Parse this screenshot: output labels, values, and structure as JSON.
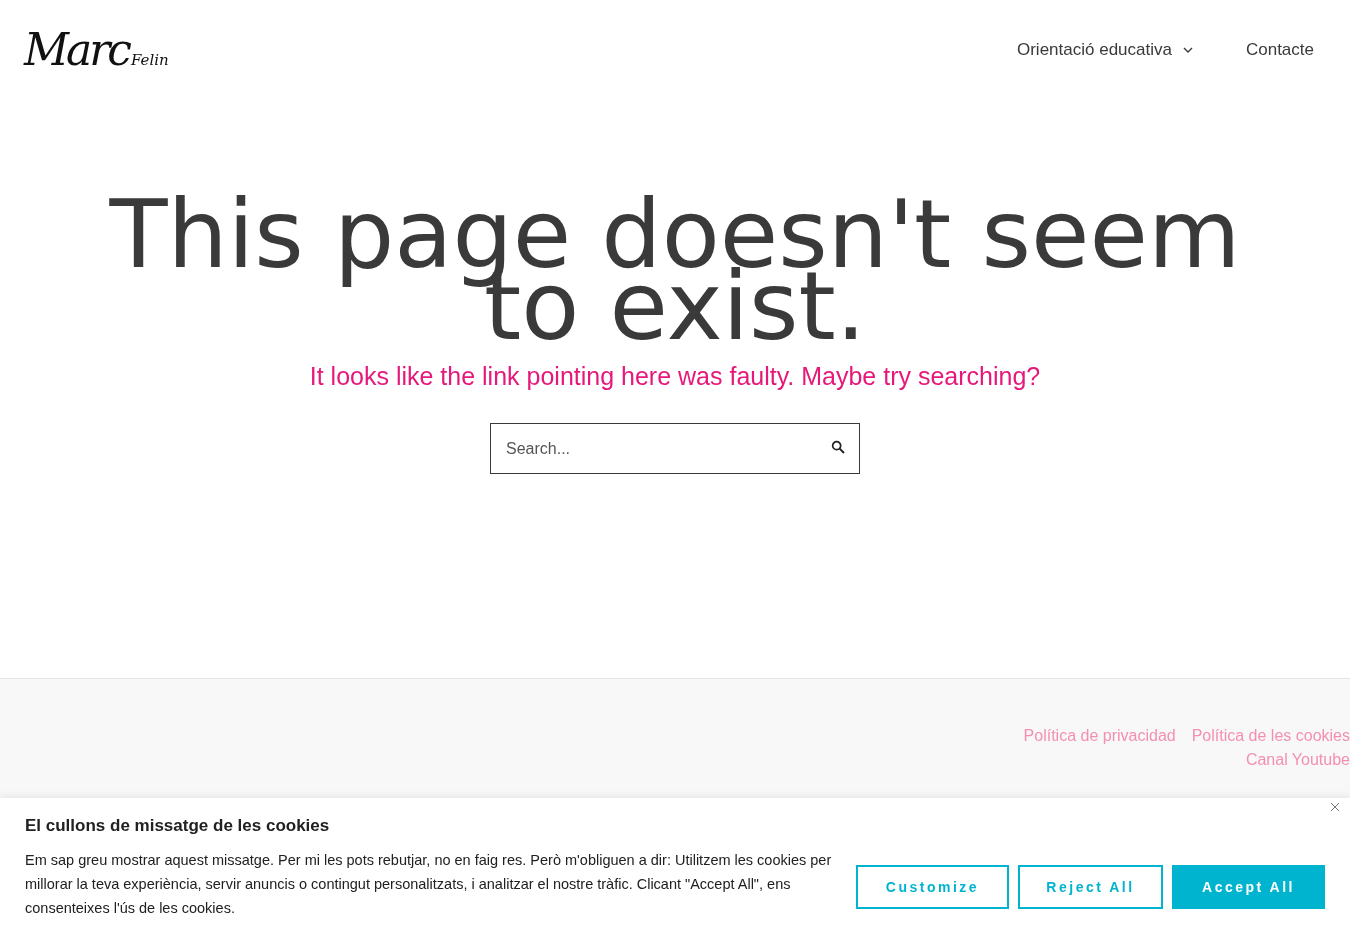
{
  "header": {
    "logo": {
      "main": "Marc",
      "small": "Felin"
    },
    "nav": [
      {
        "label": "Orientació educativa",
        "has_dropdown": true
      },
      {
        "label": "Contacte",
        "has_dropdown": false
      }
    ]
  },
  "main": {
    "title": "This page doesn't seem to exist.",
    "subtitle": "It looks like the link pointing here was faulty. Maybe try searching?",
    "search": {
      "placeholder": "Search..."
    }
  },
  "footer": {
    "links": [
      {
        "label": "Política de privacidad"
      },
      {
        "label": "Política de les cookies"
      },
      {
        "label": "Canal Youtube"
      }
    ]
  },
  "cookie_banner": {
    "title": "El cullons de missatge de les cookies",
    "text": "Em sap greu mostrar aquest missatge. Per mi les pots rebutjar, no en faig res. Però m'obliguen a dir: Utilitzem les cookies per millorar la teva experiència, servir anuncis o contingut personalitzats, i analitzar el nostre tràfic. Clicant \"Accept All\", ens consenteixes l'ús de les cookies.",
    "buttons": [
      {
        "label": "Customize",
        "kind": "outline"
      },
      {
        "label": "Reject All",
        "kind": "outline"
      },
      {
        "label": "Accept All",
        "kind": "filled"
      }
    ]
  }
}
